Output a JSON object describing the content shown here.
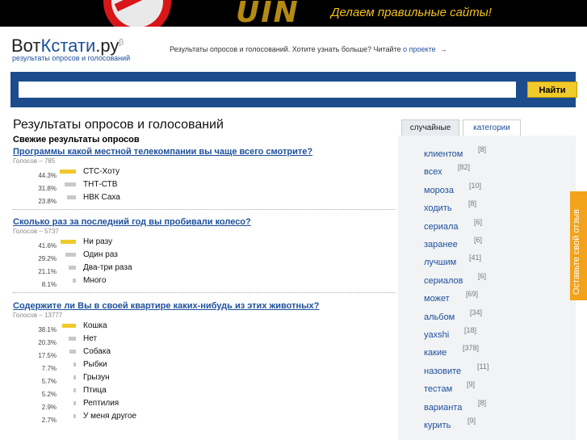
{
  "banner": {
    "brand": "UIN",
    "slogan": "Делаем правильные сайты!"
  },
  "header": {
    "logo_part1": "Вот",
    "logo_part2": "Кстати",
    "logo_part3": ".ру",
    "logo_sup": "β",
    "logo_sub": "результаты опросов и голосований",
    "tagline": "Результаты опросов и голосований. Хотите узнать больше? Читайте",
    "about_link": "о проекте",
    "about_arrow": "→"
  },
  "search": {
    "value": "",
    "placeholder": "",
    "button_label": "Найти"
  },
  "main": {
    "page_title": "Результаты опросов и голосований",
    "section_title": "Свежие результаты опросов",
    "polls": [
      {
        "question": "Программы какой местной телекомпании вы чаще всего смотрите?",
        "votes": "Голосов – 785",
        "answers": [
          {
            "pct_label": "44.3%",
            "pct": 44.3,
            "label": "СТС-Хоту",
            "top": true
          },
          {
            "pct_label": "31.8%",
            "pct": 31.8,
            "label": "ТНТ-СТВ",
            "top": false
          },
          {
            "pct_label": "23.8%",
            "pct": 23.8,
            "label": "НВК Саха",
            "top": false
          }
        ]
      },
      {
        "question": "Сколько раз за последний год вы пробивали колесо?",
        "votes": "Голосов – 5737",
        "answers": [
          {
            "pct_label": "41.6%",
            "pct": 41.6,
            "label": "Ни разу",
            "top": true
          },
          {
            "pct_label": "29.2%",
            "pct": 29.2,
            "label": "Один раз",
            "top": false
          },
          {
            "pct_label": "21.1%",
            "pct": 21.1,
            "label": "Два-три раза",
            "top": false
          },
          {
            "pct_label": "8.1%",
            "pct": 8.1,
            "label": "Много",
            "top": false
          }
        ]
      },
      {
        "question": "Содержите ли Вы в своей квартире каких-нибудь из этих животных?",
        "votes": "Голосов – 13777",
        "answers": [
          {
            "pct_label": "38.1%",
            "pct": 38.1,
            "label": "Кошка",
            "top": true
          },
          {
            "pct_label": "20.3%",
            "pct": 20.3,
            "label": "Нет",
            "top": false
          },
          {
            "pct_label": "17.5%",
            "pct": 17.5,
            "label": "Собака",
            "top": false
          },
          {
            "pct_label": "7.7%",
            "pct": 7.7,
            "label": "Рыбки",
            "top": false
          },
          {
            "pct_label": "5.7%",
            "pct": 5.7,
            "label": "Грызун",
            "top": false
          },
          {
            "pct_label": "5.2%",
            "pct": 5.2,
            "label": "Птица",
            "top": false
          },
          {
            "pct_label": "2.9%",
            "pct": 2.9,
            "label": "Рептилия",
            "top": false
          },
          {
            "pct_label": "2.7%",
            "pct": 2.7,
            "label": "У меня другое",
            "top": false
          }
        ]
      }
    ]
  },
  "sidebar": {
    "tabs": [
      "случайные",
      "категории"
    ],
    "tags": [
      {
        "word": "клиентом",
        "count": "[8]"
      },
      {
        "word": "всех",
        "count": "[82]"
      },
      {
        "word": "мороза",
        "count": "[10]"
      },
      {
        "word": "ходить",
        "count": "[8]"
      },
      {
        "word": "сериала",
        "count": "[6]"
      },
      {
        "word": "заранее",
        "count": "[6]"
      },
      {
        "word": "лучшим",
        "count": "[41]"
      },
      {
        "word": "сериалов",
        "count": "[6]"
      },
      {
        "word": "может",
        "count": "[69]"
      },
      {
        "word": "альбом",
        "count": "[34]"
      },
      {
        "word": "yaxshi",
        "count": "[18]"
      },
      {
        "word": "какие",
        "count": "[378]"
      },
      {
        "word": "назовите",
        "count": "[11]"
      },
      {
        "word": "тестам",
        "count": "[9]"
      },
      {
        "word": "варианта",
        "count": "[8]"
      },
      {
        "word": "курить",
        "count": "[9]"
      }
    ]
  },
  "feedback": {
    "label": "Оставьте свой отзыв"
  },
  "colors": {
    "accent_blue": "#1d4c8c",
    "bar_top": "#f0c92a",
    "bar_other": "#c8c8c8",
    "feedback": "#f2a21b"
  }
}
